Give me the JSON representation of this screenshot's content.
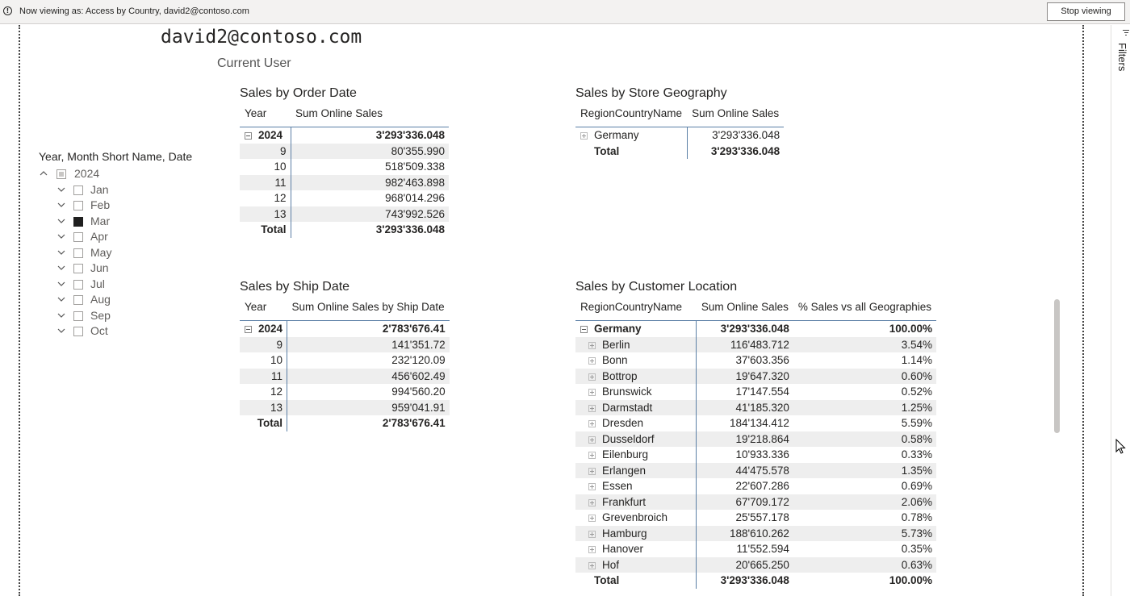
{
  "topbar": {
    "message": "Now viewing as: Access by Country, david2@contoso.com",
    "stop_button": "Stop viewing"
  },
  "filters_pane": {
    "label": "Filters"
  },
  "user_card": {
    "value": "david2@contoso.com",
    "caption": "Current User"
  },
  "slicer": {
    "title": "Year, Month Short Name, Date",
    "year": "2024",
    "months": [
      "Jan",
      "Feb",
      "Mar",
      "Apr",
      "May",
      "Jun",
      "Jul",
      "Aug",
      "Sep",
      "Oct"
    ],
    "selected_month": "Mar"
  },
  "order_date": {
    "title": "Sales by Order Date",
    "headers": [
      "Year",
      "Sum Online Sales"
    ],
    "year_row": [
      "2024",
      "3'293'336.048"
    ],
    "rows": [
      [
        "9",
        "80'355.990"
      ],
      [
        "10",
        "518'509.338"
      ],
      [
        "11",
        "982'463.898"
      ],
      [
        "12",
        "968'014.296"
      ],
      [
        "13",
        "743'992.526"
      ]
    ],
    "total": [
      "Total",
      "3'293'336.048"
    ]
  },
  "ship_date": {
    "title": "Sales by Ship Date",
    "headers": [
      "Year",
      "Sum Online Sales by Ship Date"
    ],
    "year_row": [
      "2024",
      "2'783'676.41"
    ],
    "rows": [
      [
        "9",
        "141'351.72"
      ],
      [
        "10",
        "232'120.09"
      ],
      [
        "11",
        "456'602.49"
      ],
      [
        "12",
        "994'560.20"
      ],
      [
        "13",
        "959'041.91"
      ]
    ],
    "total": [
      "Total",
      "2'783'676.41"
    ]
  },
  "store_geo": {
    "title": "Sales by Store Geography",
    "headers": [
      "RegionCountryName",
      "Sum Online Sales"
    ],
    "rows": [
      [
        "Germany",
        "3'293'336.048"
      ]
    ],
    "total": [
      "Total",
      "3'293'336.048"
    ]
  },
  "customer_loc": {
    "title": "Sales by Customer Location",
    "headers": [
      "RegionCountryName",
      "Sum Online Sales",
      "% Sales vs all Geographies"
    ],
    "country_row": [
      "Germany",
      "3'293'336.048",
      "100.00%"
    ],
    "rows": [
      [
        "Berlin",
        "116'483.712",
        "3.54%"
      ],
      [
        "Bonn",
        "37'603.356",
        "1.14%"
      ],
      [
        "Bottrop",
        "19'647.320",
        "0.60%"
      ],
      [
        "Brunswick",
        "17'147.554",
        "0.52%"
      ],
      [
        "Darmstadt",
        "41'185.320",
        "1.25%"
      ],
      [
        "Dresden",
        "184'134.412",
        "5.59%"
      ],
      [
        "Dusseldorf",
        "19'218.864",
        "0.58%"
      ],
      [
        "Eilenburg",
        "10'933.336",
        "0.33%"
      ],
      [
        "Erlangen",
        "44'475.578",
        "1.35%"
      ],
      [
        "Essen",
        "22'607.286",
        "0.69%"
      ],
      [
        "Frankfurt",
        "67'709.172",
        "2.06%"
      ],
      [
        "Grevenbroich",
        "25'557.178",
        "0.78%"
      ],
      [
        "Hamburg",
        "188'610.262",
        "5.73%"
      ],
      [
        "Hanover",
        "11'552.594",
        "0.35%"
      ],
      [
        "Hof",
        "20'665.250",
        "0.63%"
      ]
    ],
    "total": [
      "Total",
      "3'293'336.048",
      "100.00%"
    ]
  }
}
